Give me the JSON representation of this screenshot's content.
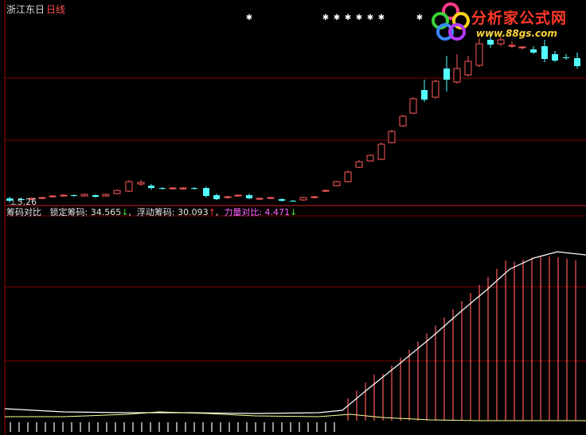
{
  "header": {
    "stock_name": "浙江东日",
    "period": "日线"
  },
  "price_panel": {
    "low_label": "5.26"
  },
  "indicator": {
    "name": "筹码对比",
    "items": [
      {
        "label": "锁定筹码",
        "value": "34.565",
        "arrow": "↓",
        "color": "#e6e6e6",
        "arrow_color": "#40e040"
      },
      {
        "label": "浮动筹码",
        "value": "30.093",
        "arrow": "↑",
        "color": "#ffff66",
        "arrow_color": "#ff4040"
      },
      {
        "label": "力量对比",
        "value": "4.471",
        "arrow": "↓",
        "color": "#ff66ff",
        "arrow_color": "#40e040"
      }
    ]
  },
  "logo": {
    "text": "分析家公式网",
    "url": "www.88gs.com"
  },
  "colors": {
    "up_candle": "#ff5a5a",
    "down_candle": "#54ffff",
    "grid": "#800000",
    "curve": "#ffffff",
    "hist": "#ff5a5a"
  }
}
